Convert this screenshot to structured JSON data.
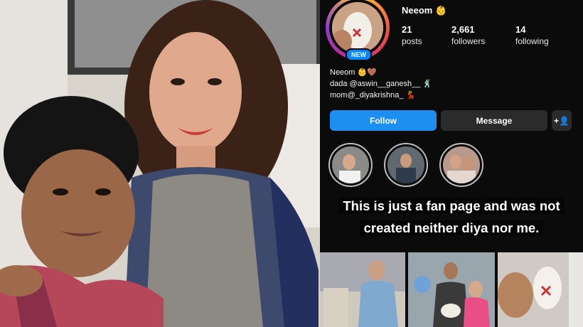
{
  "profile": {
    "username": "Neeom 👶",
    "badge": "NEW",
    "posts_count": "21",
    "posts_label": "posts",
    "followers_count": "2,661",
    "followers_label": "followers",
    "following_count": "14",
    "following_label": "following"
  },
  "bio": {
    "name_line": "Neeom 👶🤎",
    "dada_line": "dada @aswin__ganesh__ 🕺",
    "mom_line": "mom@_diyakrishna_ 💃"
  },
  "actions": {
    "follow_label": "Follow",
    "message_label": "Message",
    "add_user_glyph": "+👤"
  },
  "caption": {
    "line1": "This is just a fan page and was not",
    "line2": "created neither diya nor me."
  },
  "colors": {
    "follow_button": "#1d8ff0",
    "secondary_button": "#2b2b2b",
    "new_badge": "#0a84ff",
    "background": "#0b0b0b"
  }
}
